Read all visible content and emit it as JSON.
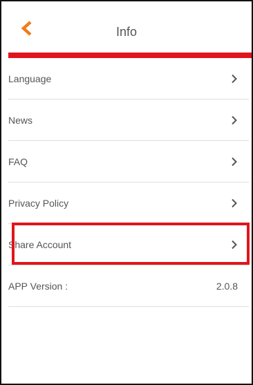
{
  "header": {
    "title": "Info",
    "back_icon": "chevron-left-icon",
    "back_icon_color": "#f07c1b"
  },
  "accent_color": "#e1151d",
  "menu": {
    "items": [
      {
        "label": "Language",
        "icon": "chevron-right-icon"
      },
      {
        "label": "News",
        "icon": "chevron-right-icon"
      },
      {
        "label": "FAQ",
        "icon": "chevron-right-icon"
      },
      {
        "label": "Privacy Policy",
        "icon": "chevron-right-icon"
      },
      {
        "label": "Share Account",
        "icon": "chevron-right-icon",
        "highlighted": true
      }
    ],
    "version": {
      "label": "APP Version :",
      "value": "2.0.8"
    }
  }
}
